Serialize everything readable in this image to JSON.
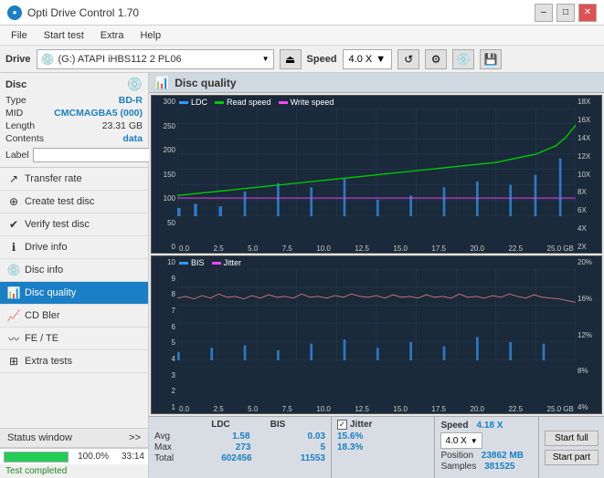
{
  "titlebar": {
    "title": "Opti Drive Control 1.70",
    "min_label": "–",
    "max_label": "□",
    "close_label": "✕"
  },
  "menubar": {
    "items": [
      "File",
      "Start test",
      "Extra",
      "Help"
    ]
  },
  "drivebar": {
    "label": "Drive",
    "drive_value": "(G:)  ATAPI iHBS112  2 PL06",
    "speed_label": "Speed",
    "speed_value": "4.0 X"
  },
  "disc": {
    "header": "Disc",
    "type_label": "Type",
    "type_value": "BD-R",
    "mid_label": "MID",
    "mid_value": "CMCMAGBA5 (000)",
    "length_label": "Length",
    "length_value": "23.31 GB",
    "contents_label": "Contents",
    "contents_value": "data",
    "label_label": "Label"
  },
  "nav": {
    "items": [
      {
        "id": "transfer-rate",
        "label": "Transfer rate",
        "icon": "↗"
      },
      {
        "id": "create-test-disc",
        "label": "Create test disc",
        "icon": "⊕"
      },
      {
        "id": "verify-test-disc",
        "label": "Verify test disc",
        "icon": "✔"
      },
      {
        "id": "drive-info",
        "label": "Drive info",
        "icon": "ℹ"
      },
      {
        "id": "disc-info",
        "label": "Disc info",
        "icon": "💿"
      },
      {
        "id": "disc-quality",
        "label": "Disc quality",
        "icon": "📊",
        "active": true
      },
      {
        "id": "cd-bler",
        "label": "CD Bler",
        "icon": "📈"
      },
      {
        "id": "fe-te",
        "label": "FE / TE",
        "icon": "〰"
      },
      {
        "id": "extra-tests",
        "label": "Extra tests",
        "icon": "⊞"
      }
    ]
  },
  "status_window": {
    "label": "Status window",
    "arrows": ">>"
  },
  "progress": {
    "value": "100.0%",
    "time": "33:14"
  },
  "dq_panel": {
    "title": "Disc quality",
    "chart1": {
      "legends": [
        {
          "label": "LDC",
          "color": "#3399ff"
        },
        {
          "label": "Read speed",
          "color": "#00cc00"
        },
        {
          "label": "Write speed",
          "color": "#ff44ff"
        }
      ],
      "y_left": [
        "300",
        "250",
        "200",
        "150",
        "100",
        "50",
        "0"
      ],
      "y_right": [
        "18X",
        "16X",
        "14X",
        "12X",
        "10X",
        "8X",
        "6X",
        "4X",
        "2X"
      ],
      "x_labels": [
        "0.0",
        "2.5",
        "5.0",
        "7.5",
        "10.0",
        "12.5",
        "15.0",
        "17.5",
        "20.0",
        "22.5",
        "25.0 GB"
      ]
    },
    "chart2": {
      "legends": [
        {
          "label": "BIS",
          "color": "#3399ff"
        },
        {
          "label": "Jitter",
          "color": "#ff44ff"
        }
      ],
      "y_left": [
        "10",
        "9",
        "8",
        "7",
        "6",
        "5",
        "4",
        "3",
        "2",
        "1"
      ],
      "y_right": [
        "20%",
        "16%",
        "12%",
        "8%",
        "4%"
      ],
      "x_labels": [
        "0.0",
        "2.5",
        "5.0",
        "7.5",
        "10.0",
        "12.5",
        "15.0",
        "17.5",
        "20.0",
        "22.5",
        "25.0 GB"
      ]
    },
    "stats": {
      "ldc_header": "LDC",
      "bis_header": "BIS",
      "jitter_header": "Jitter",
      "jitter_checked": true,
      "speed_header": "Speed",
      "speed_value": "4.18 X",
      "speed_select": "4.0 X",
      "rows": [
        {
          "label": "Avg",
          "ldc": "1.58",
          "bis": "0.03",
          "jitter": "15.6%"
        },
        {
          "label": "Max",
          "ldc": "273",
          "bis": "5",
          "jitter": "18.3%"
        },
        {
          "label": "Total",
          "ldc": "602456",
          "bis": "11553",
          "jitter": ""
        }
      ],
      "position_label": "Position",
      "position_value": "23862 MB",
      "samples_label": "Samples",
      "samples_value": "381525"
    },
    "buttons": {
      "start_full": "Start full",
      "start_part": "Start part"
    }
  },
  "status_completed": "Test completed"
}
